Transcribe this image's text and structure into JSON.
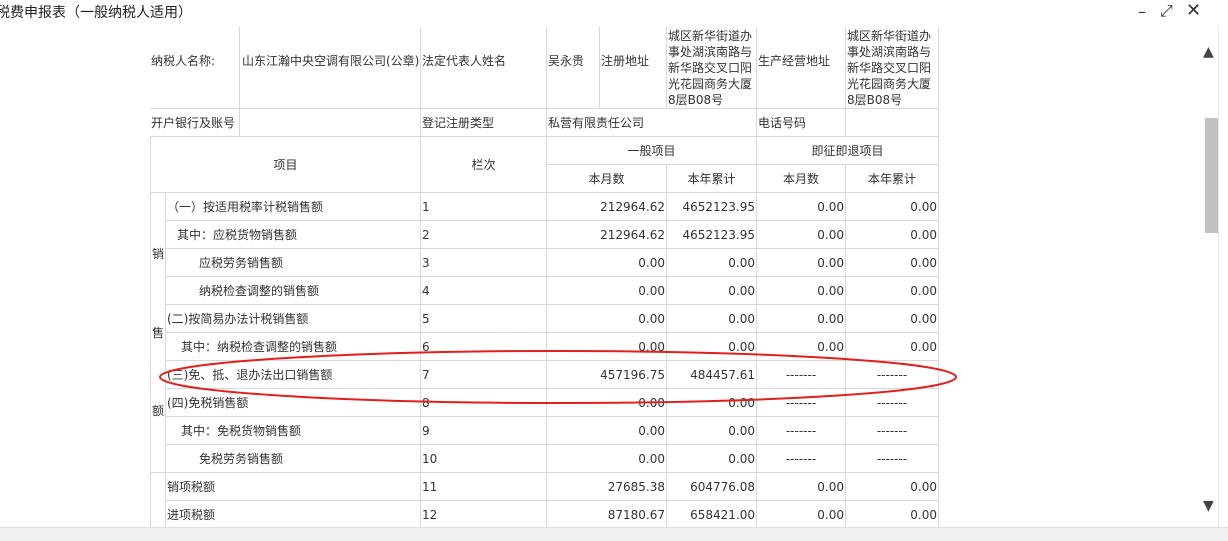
{
  "window": {
    "title": "税费申报表（一般纳税人适用）",
    "controls": {
      "minimize": "–",
      "maximize": "⤢",
      "close": "✕"
    }
  },
  "header": {
    "taxpayer_name_label": "纳税人名称:",
    "taxpayer_name": "山东江瀚中央空调有限公司(公章)",
    "legal_rep_label": "法定代表人姓名",
    "legal_rep": "吴永贵",
    "reg_address_label": "注册地址",
    "reg_address": "城区新华街道办事处湖滨南路与新华路交叉口阳光花园商务大厦8层B08号",
    "biz_address_label": "生产经营地址",
    "biz_address": "城区新华街道办事处湖滨南路与新华路交叉口阳光花园商务大厦8层B08号",
    "bank_label": "开户银行及账号",
    "bank": "",
    "reg_type_label": "登记注册类型",
    "reg_type": "私营有限责任公司",
    "phone_label": "电话号码",
    "phone": ""
  },
  "columns": {
    "item": "项目",
    "line": "栏次",
    "general": "一般项目",
    "refund": "即征即退项目",
    "month": "本月数",
    "ytd": "本年累计"
  },
  "group_chars": [
    "销",
    "售",
    "额"
  ],
  "rows": [
    {
      "label": "（一）按适用税率计税销售额",
      "line": "1",
      "gm": "212964.62",
      "gy": "4652123.95",
      "rm": "0.00",
      "ry": "0.00"
    },
    {
      "label": "其中：应税货物销售额",
      "line": "2",
      "gm": "212964.62",
      "gy": "4652123.95",
      "rm": "0.00",
      "ry": "0.00"
    },
    {
      "label": "应税劳务销售额",
      "line": "3",
      "gm": "0.00",
      "gy": "0.00",
      "rm": "0.00",
      "ry": "0.00"
    },
    {
      "label": "纳税检查调整的销售额",
      "line": "4",
      "gm": "0.00",
      "gy": "0.00",
      "rm": "0.00",
      "ry": "0.00"
    },
    {
      "label": "(二)按简易办法计税销售额",
      "line": "5",
      "gm": "0.00",
      "gy": "0.00",
      "rm": "0.00",
      "ry": "0.00"
    },
    {
      "label": "其中：纳税检查调整的销售额",
      "line": "6",
      "gm": "0.00",
      "gy": "0.00",
      "rm": "0.00",
      "ry": "0.00"
    },
    {
      "label": "(三)免、抵、退办法出口销售额",
      "line": "7",
      "gm": "457196.75",
      "gy": "484457.61",
      "rm": "-------",
      "ry": "-------"
    },
    {
      "label": "(四)免税销售额",
      "line": "8",
      "gm": "0.00",
      "gy": "0.00",
      "rm": "-------",
      "ry": "-------"
    },
    {
      "label": "其中：免税货物销售额",
      "line": "9",
      "gm": "0.00",
      "gy": "0.00",
      "rm": "-------",
      "ry": "-------"
    },
    {
      "label": "免税劳务销售额",
      "line": "10",
      "gm": "0.00",
      "gy": "0.00",
      "rm": "-------",
      "ry": "-------"
    },
    {
      "label": "销项税额",
      "line": "11",
      "gm": "27685.38",
      "gy": "604776.08",
      "rm": "0.00",
      "ry": "0.00"
    },
    {
      "label": "进项税额",
      "line": "12",
      "gm": "87180.67",
      "gy": "658421.00",
      "rm": "0.00",
      "ry": "0.00"
    }
  ],
  "annotation": {
    "color": "#e0201c"
  }
}
